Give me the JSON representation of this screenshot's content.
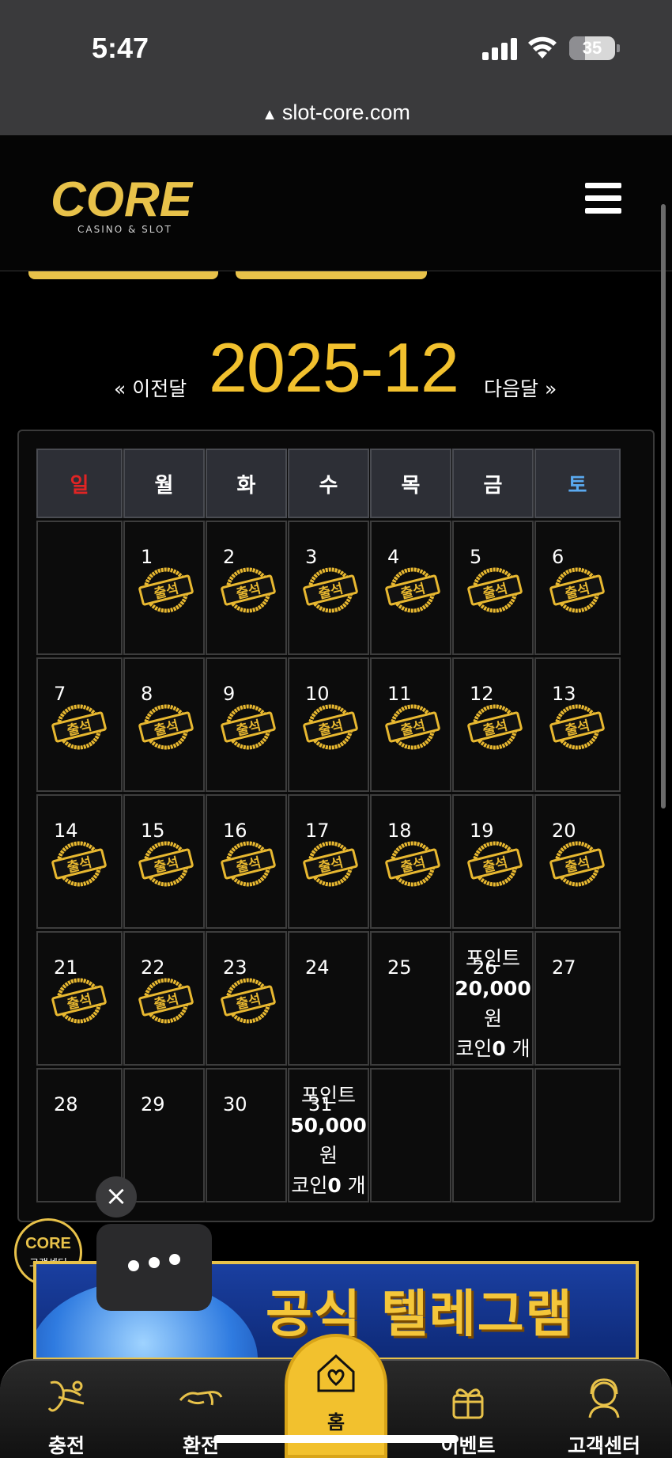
{
  "status_bar": {
    "time": "5:47",
    "battery": "35",
    "battery_level": 0.35
  },
  "browser": {
    "url": "slot-core.com"
  },
  "header": {
    "logo_text": "CORE",
    "logo_subtitle": "CASINO & SLOT"
  },
  "calendar": {
    "prev_label": "« 이전달",
    "next_label": "다음달 »",
    "month_title": "2025-12",
    "weekdays": [
      "일",
      "월",
      "화",
      "수",
      "목",
      "금",
      "토"
    ],
    "weekday_colors": [
      "#e02424",
      "#ffffff",
      "#ffffff",
      "#ffffff",
      "#ffffff",
      "#ffffff",
      "#5aaaf0"
    ],
    "stamp_label": "출석",
    "days": [
      {
        "d": ""
      },
      {
        "d": "1",
        "s": true
      },
      {
        "d": "2",
        "s": true
      },
      {
        "d": "3",
        "s": true
      },
      {
        "d": "4",
        "s": true
      },
      {
        "d": "5",
        "s": true
      },
      {
        "d": "6",
        "s": true
      },
      {
        "d": "7",
        "s": true
      },
      {
        "d": "8",
        "s": true
      },
      {
        "d": "9",
        "s": true
      },
      {
        "d": "10",
        "s": true
      },
      {
        "d": "11",
        "s": true
      },
      {
        "d": "12",
        "s": true
      },
      {
        "d": "13",
        "s": true
      },
      {
        "d": "14",
        "s": true
      },
      {
        "d": "15",
        "s": true
      },
      {
        "d": "16",
        "s": true
      },
      {
        "d": "17",
        "s": true
      },
      {
        "d": "18",
        "s": true
      },
      {
        "d": "19",
        "s": true
      },
      {
        "d": "20",
        "s": true
      },
      {
        "d": "21",
        "s": true
      },
      {
        "d": "22",
        "s": true
      },
      {
        "d": "23",
        "s": true
      },
      {
        "d": "24"
      },
      {
        "d": "25"
      },
      {
        "d": "26",
        "reward": {
          "point_label": "포인트",
          "amount": "20,000",
          "unit": "원",
          "coin_prefix": "코인",
          "coin_count": "0",
          "coin_unit": " 개"
        }
      },
      {
        "d": "27"
      },
      {
        "d": "28"
      },
      {
        "d": "29"
      },
      {
        "d": "30"
      },
      {
        "d": "31",
        "reward": {
          "point_label": "포인트",
          "amount": "50,000",
          "unit": "원",
          "coin_prefix": "코인",
          "coin_count": "0",
          "coin_unit": " 개"
        }
      },
      {
        "d": ""
      },
      {
        "d": ""
      },
      {
        "d": ""
      }
    ]
  },
  "floating": {
    "close_icon": "×",
    "cs_badge_logo": "CORE",
    "cs_badge_label": "고객센터"
  },
  "banner": {
    "text": "공식 텔레그램"
  },
  "bottom_nav": {
    "items": [
      {
        "label": "충전",
        "icon": "deposit-icon"
      },
      {
        "label": "환전",
        "icon": "withdraw-icon"
      },
      {
        "label": "홈",
        "icon": "home-heart-icon"
      },
      {
        "label": "이벤트",
        "icon": "gift-icon"
      },
      {
        "label": "고객센터",
        "icon": "support-icon"
      }
    ]
  },
  "colors": {
    "accent": "#f2c12e",
    "background": "#000000",
    "cell": "#0c0c0c",
    "header_cell": "#2d2f36"
  }
}
